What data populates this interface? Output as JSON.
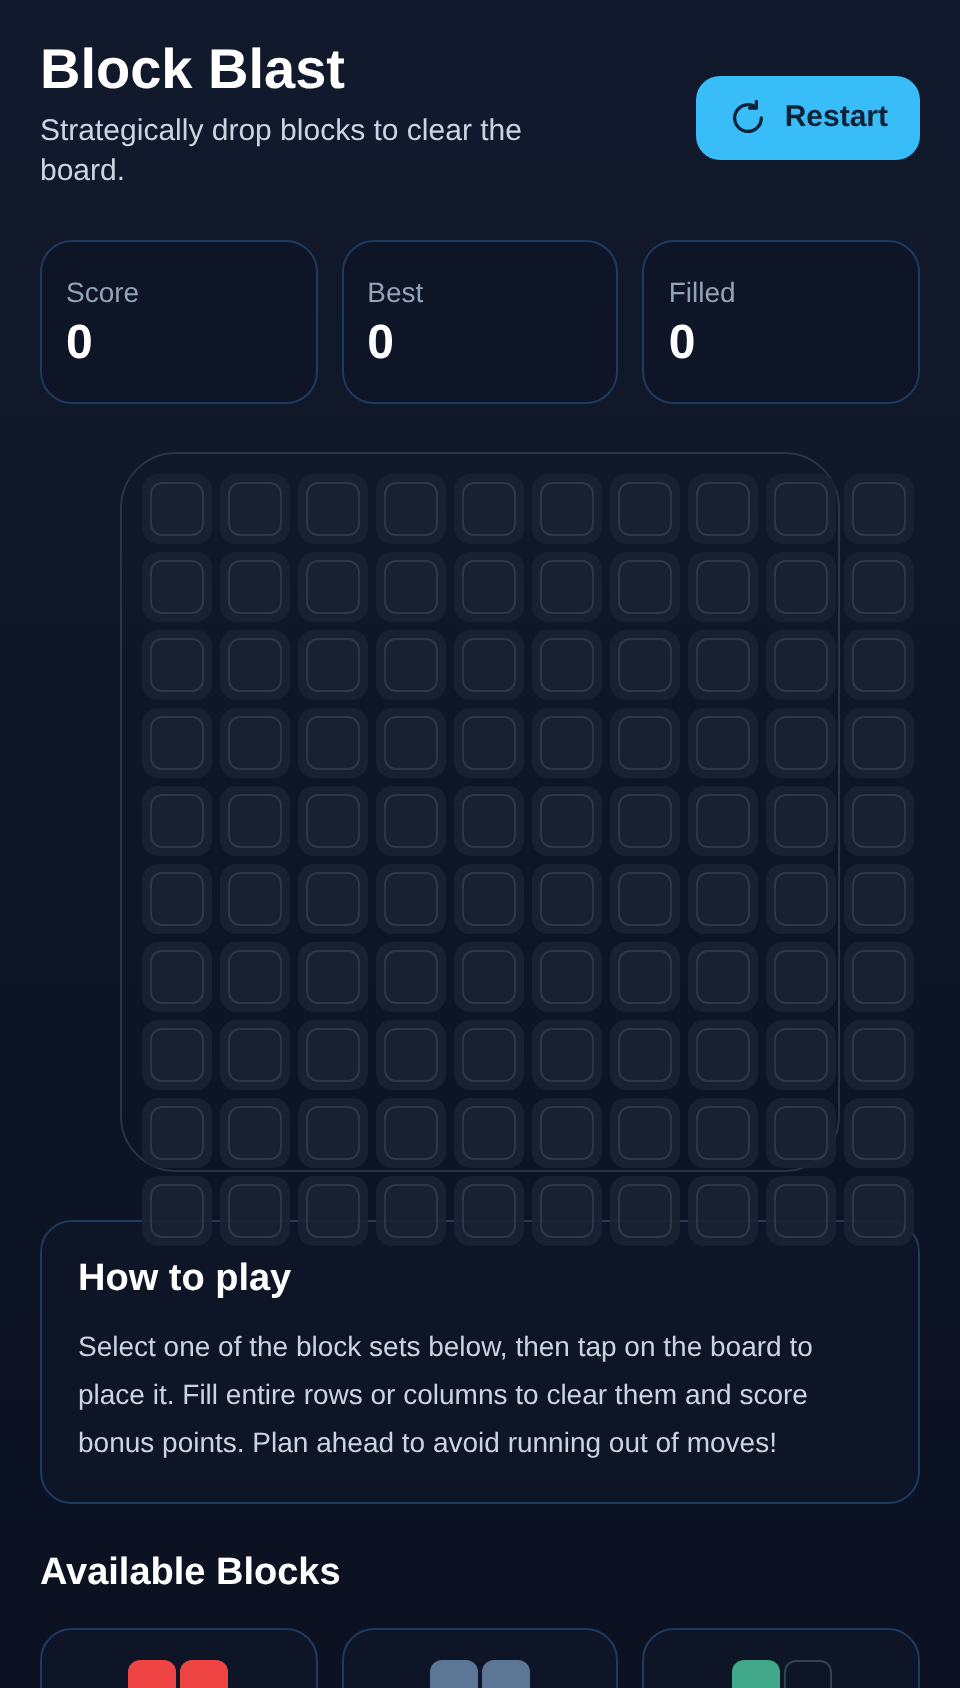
{
  "header": {
    "title": "Block Blast",
    "subtitle": "Strategically drop blocks to clear the board.",
    "restart_button": "Restart"
  },
  "stats": [
    {
      "label": "Score",
      "value": "0"
    },
    {
      "label": "Best",
      "value": "0"
    },
    {
      "label": "Filled",
      "value": "0"
    }
  ],
  "board": {
    "rows": [
      {
        "cells": [
          {
            "filled": false
          },
          {
            "filled": false
          },
          {
            "filled": false
          },
          {
            "filled": false
          },
          {
            "filled": false
          },
          {
            "filled": false
          },
          {
            "filled": false
          },
          {
            "filled": false
          },
          {
            "filled": false
          },
          {
            "filled": false
          }
        ]
      },
      {
        "cells": [
          {
            "filled": false
          },
          {
            "filled": false
          },
          {
            "filled": false
          },
          {
            "filled": false
          },
          {
            "filled": false
          },
          {
            "filled": false
          },
          {
            "filled": false
          },
          {
            "filled": false
          },
          {
            "filled": false
          },
          {
            "filled": false
          }
        ]
      },
      {
        "cells": [
          {
            "filled": false
          },
          {
            "filled": false
          },
          {
            "filled": false
          },
          {
            "filled": false
          },
          {
            "filled": false
          },
          {
            "filled": false
          },
          {
            "filled": false
          },
          {
            "filled": false
          },
          {
            "filled": false
          },
          {
            "filled": false
          }
        ]
      },
      {
        "cells": [
          {
            "filled": false
          },
          {
            "filled": false
          },
          {
            "filled": false
          },
          {
            "filled": false
          },
          {
            "filled": false
          },
          {
            "filled": false
          },
          {
            "filled": false
          },
          {
            "filled": false
          },
          {
            "filled": false
          },
          {
            "filled": false
          }
        ]
      },
      {
        "cells": [
          {
            "filled": false
          },
          {
            "filled": false
          },
          {
            "filled": false
          },
          {
            "filled": false
          },
          {
            "filled": false
          },
          {
            "filled": false
          },
          {
            "filled": false
          },
          {
            "filled": false
          },
          {
            "filled": false
          },
          {
            "filled": false
          }
        ]
      },
      {
        "cells": [
          {
            "filled": false
          },
          {
            "filled": false
          },
          {
            "filled": false
          },
          {
            "filled": false
          },
          {
            "filled": false
          },
          {
            "filled": false
          },
          {
            "filled": false
          },
          {
            "filled": false
          },
          {
            "filled": false
          },
          {
            "filled": false
          }
        ]
      },
      {
        "cells": [
          {
            "filled": false
          },
          {
            "filled": false
          },
          {
            "filled": false
          },
          {
            "filled": false
          },
          {
            "filled": false
          },
          {
            "filled": false
          },
          {
            "filled": false
          },
          {
            "filled": false
          },
          {
            "filled": false
          },
          {
            "filled": false
          }
        ]
      },
      {
        "cells": [
          {
            "filled": false
          },
          {
            "filled": false
          },
          {
            "filled": false
          },
          {
            "filled": false
          },
          {
            "filled": false
          },
          {
            "filled": false
          },
          {
            "filled": false
          },
          {
            "filled": false
          },
          {
            "filled": false
          },
          {
            "filled": false
          }
        ]
      },
      {
        "cells": [
          {
            "filled": false
          },
          {
            "filled": false
          },
          {
            "filled": false
          },
          {
            "filled": false
          },
          {
            "filled": false
          },
          {
            "filled": false
          },
          {
            "filled": false
          },
          {
            "filled": false
          },
          {
            "filled": false
          },
          {
            "filled": false
          }
        ]
      },
      {
        "cells": [
          {
            "filled": false
          },
          {
            "filled": false
          },
          {
            "filled": false
          },
          {
            "filled": false
          },
          {
            "filled": false
          },
          {
            "filled": false
          },
          {
            "filled": false
          },
          {
            "filled": false
          },
          {
            "filled": false
          },
          {
            "filled": false
          }
        ]
      }
    ]
  },
  "how_to_play": {
    "title": "How to play",
    "text": "Select one of the block sets below, then tap on the board to place it. Fill entire rows or columns to clear them and score bonus points. Plan ahead to avoid running out of moves!"
  },
  "available_blocks": {
    "title": "Available Blocks",
    "pieces": [
      {
        "color": "#ef4444",
        "cells": [
          {
            "filled": true
          },
          {
            "filled": true
          }
        ]
      },
      {
        "color": "#5b7795",
        "cells": [
          {
            "filled": true
          },
          {
            "filled": true
          }
        ]
      },
      {
        "color": "#41a98a",
        "cells": [
          {
            "filled": true
          },
          {
            "filled": false
          }
        ]
      }
    ]
  }
}
